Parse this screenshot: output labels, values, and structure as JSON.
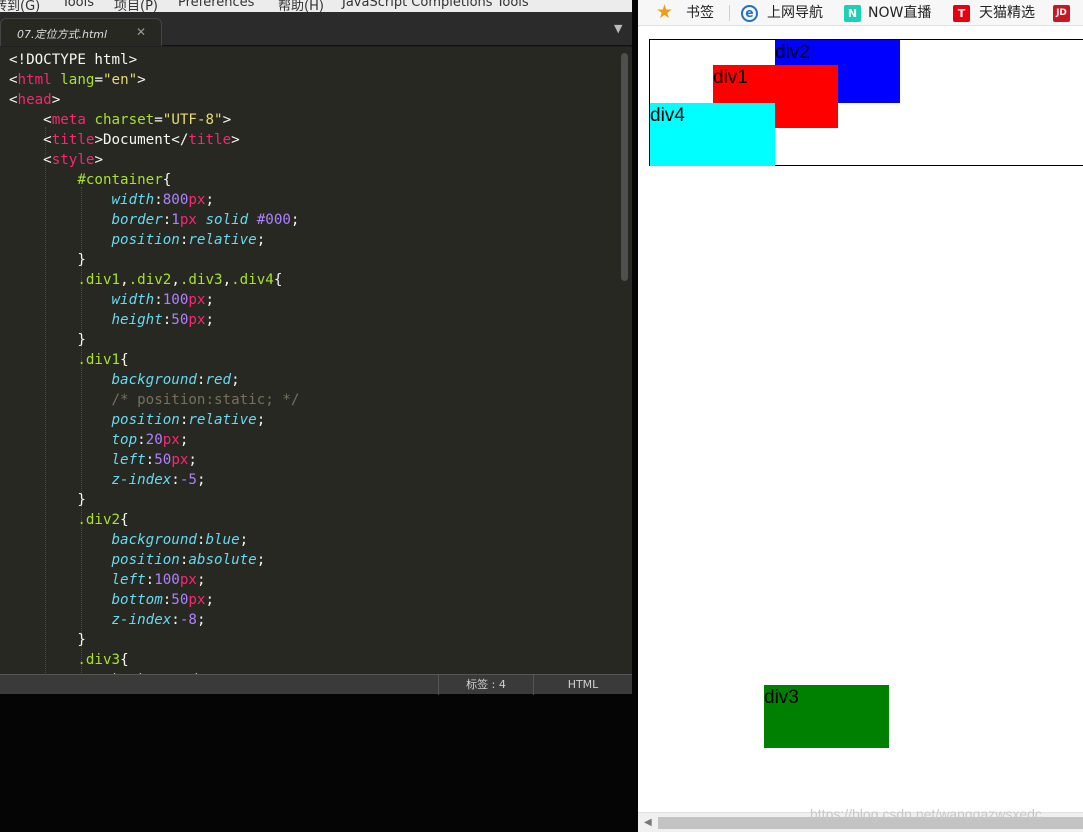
{
  "menu": {
    "items": [
      "转到(G)",
      "Tools",
      "项目(P)",
      "Preferences",
      "帮助(H)",
      "JavaScript Completions Tools"
    ]
  },
  "editor": {
    "tab": {
      "label": "07.定位方式.html"
    },
    "tab_close_icon": "close-icon",
    "tab_overflow_icon": "chevron-down-icon",
    "code": [
      [
        [
          "w",
          "<!DOCTYPE html>"
        ]
      ],
      [
        [
          "w",
          "<"
        ],
        [
          "t",
          "html"
        ],
        [
          "w",
          " "
        ],
        [
          "a",
          "lang"
        ],
        [
          "w",
          "="
        ],
        [
          "s",
          "\"en\""
        ],
        [
          "w",
          ">"
        ]
      ],
      [
        [
          "w",
          "<"
        ],
        [
          "t",
          "head"
        ],
        [
          "w",
          ">"
        ]
      ],
      [
        [
          "w",
          "    <"
        ],
        [
          "t",
          "meta"
        ],
        [
          "w",
          " "
        ],
        [
          "a",
          "charset"
        ],
        [
          "w",
          "="
        ],
        [
          "s",
          "\"UTF-8\""
        ],
        [
          "w",
          ">"
        ]
      ],
      [
        [
          "w",
          "    <"
        ],
        [
          "t",
          "title"
        ],
        [
          "w",
          ">Document</"
        ],
        [
          "t",
          "title"
        ],
        [
          "w",
          ">"
        ]
      ],
      [
        [
          "w",
          "    <"
        ],
        [
          "t",
          "style"
        ],
        [
          "w",
          ">"
        ]
      ],
      [
        [
          "w",
          "        "
        ],
        [
          "a",
          "#container"
        ],
        [
          "w",
          "{"
        ]
      ],
      [
        [
          "w",
          "            "
        ],
        [
          "p",
          "width"
        ],
        [
          "w",
          ":"
        ],
        [
          "n",
          "800"
        ],
        [
          "t",
          "px"
        ],
        [
          "w",
          ";"
        ]
      ],
      [
        [
          "w",
          "            "
        ],
        [
          "p",
          "border"
        ],
        [
          "w",
          ":"
        ],
        [
          "n",
          "1"
        ],
        [
          "t",
          "px"
        ],
        [
          "w",
          " "
        ],
        [
          "p",
          "solid"
        ],
        [
          "w",
          " "
        ],
        [
          "n",
          "#000"
        ],
        [
          "w",
          ";"
        ]
      ],
      [
        [
          "w",
          "            "
        ],
        [
          "p",
          "position"
        ],
        [
          "w",
          ":"
        ],
        [
          "p",
          "relative"
        ],
        [
          "w",
          ";"
        ]
      ],
      [
        [
          "w",
          "        }"
        ]
      ],
      [
        [
          "w",
          "        "
        ],
        [
          "a",
          ".div1"
        ],
        [
          "w",
          ","
        ],
        [
          "a",
          ".div2"
        ],
        [
          "w",
          ","
        ],
        [
          "a",
          ".div3"
        ],
        [
          "w",
          ","
        ],
        [
          "a",
          ".div4"
        ],
        [
          "w",
          "{"
        ]
      ],
      [
        [
          "w",
          "            "
        ],
        [
          "p",
          "width"
        ],
        [
          "w",
          ":"
        ],
        [
          "n",
          "100"
        ],
        [
          "t",
          "px"
        ],
        [
          "w",
          ";"
        ]
      ],
      [
        [
          "w",
          "            "
        ],
        [
          "p",
          "height"
        ],
        [
          "w",
          ":"
        ],
        [
          "n",
          "50"
        ],
        [
          "t",
          "px"
        ],
        [
          "w",
          ";"
        ]
      ],
      [
        [
          "w",
          "        }"
        ]
      ],
      [
        [
          "w",
          "        "
        ],
        [
          "a",
          ".div1"
        ],
        [
          "w",
          "{"
        ]
      ],
      [
        [
          "w",
          "            "
        ],
        [
          "p",
          "background"
        ],
        [
          "w",
          ":"
        ],
        [
          "p",
          "red"
        ],
        [
          "w",
          ";"
        ]
      ],
      [
        [
          "w",
          "            "
        ],
        [
          "c",
          "/* position:static; */"
        ]
      ],
      [
        [
          "w",
          "            "
        ],
        [
          "p",
          "position"
        ],
        [
          "w",
          ":"
        ],
        [
          "p",
          "relative"
        ],
        [
          "w",
          ";"
        ]
      ],
      [
        [
          "w",
          "            "
        ],
        [
          "p",
          "top"
        ],
        [
          "w",
          ":"
        ],
        [
          "n",
          "20"
        ],
        [
          "t",
          "px"
        ],
        [
          "w",
          ";"
        ]
      ],
      [
        [
          "w",
          "            "
        ],
        [
          "p",
          "left"
        ],
        [
          "w",
          ":"
        ],
        [
          "n",
          "50"
        ],
        [
          "t",
          "px"
        ],
        [
          "w",
          ";"
        ]
      ],
      [
        [
          "w",
          "            "
        ],
        [
          "p",
          "z-index"
        ],
        [
          "w",
          ":"
        ],
        [
          "n",
          "-5"
        ],
        [
          "w",
          ";"
        ]
      ],
      [
        [
          "w",
          "        }"
        ]
      ],
      [
        [
          "w",
          "        "
        ],
        [
          "a",
          ".div2"
        ],
        [
          "w",
          "{"
        ]
      ],
      [
        [
          "w",
          "            "
        ],
        [
          "p",
          "background"
        ],
        [
          "w",
          ":"
        ],
        [
          "p",
          "blue"
        ],
        [
          "w",
          ";"
        ]
      ],
      [
        [
          "w",
          "            "
        ],
        [
          "p",
          "position"
        ],
        [
          "w",
          ":"
        ],
        [
          "p",
          "absolute"
        ],
        [
          "w",
          ";"
        ]
      ],
      [
        [
          "w",
          "            "
        ],
        [
          "p",
          "left"
        ],
        [
          "w",
          ":"
        ],
        [
          "n",
          "100"
        ],
        [
          "t",
          "px"
        ],
        [
          "w",
          ";"
        ]
      ],
      [
        [
          "w",
          "            "
        ],
        [
          "p",
          "bottom"
        ],
        [
          "w",
          ":"
        ],
        [
          "n",
          "50"
        ],
        [
          "t",
          "px"
        ],
        [
          "w",
          ";"
        ]
      ],
      [
        [
          "w",
          "            "
        ],
        [
          "p",
          "z-index"
        ],
        [
          "w",
          ":"
        ],
        [
          "n",
          "-8"
        ],
        [
          "w",
          ";"
        ]
      ],
      [
        [
          "w",
          "        }"
        ]
      ],
      [
        [
          "w",
          "        "
        ],
        [
          "a",
          ".div3"
        ],
        [
          "w",
          "{"
        ]
      ],
      [
        [
          "w",
          "            "
        ],
        [
          "p",
          "background"
        ],
        [
          "w",
          ":"
        ]
      ]
    ],
    "status": {
      "tags": "标签 : 4",
      "syntax": "HTML"
    }
  },
  "browser": {
    "bookmarks": [
      {
        "label": "书签",
        "icon": "star-icon",
        "icon_color": "#f39c12"
      },
      {
        "label": "上网导航",
        "icon": "ie-icon",
        "icon_color": "#1e73c8"
      },
      {
        "label": "NOW直播",
        "icon": "now-icon",
        "icon_color": "#1fcfb3"
      },
      {
        "label": "天猫精选",
        "icon": "tmall-icon",
        "icon_color": "#e60012"
      },
      {
        "label": "",
        "icon": "jd-icon",
        "icon_color": "#c81623"
      }
    ],
    "icon_text": {
      "ie": "e",
      "now": "N",
      "tmall": "T",
      "jd": "JD"
    },
    "demo_boxes": {
      "div1": {
        "label": "div1",
        "color": "#ff0000"
      },
      "div2": {
        "label": "div2",
        "color": "#0000ff"
      },
      "div3": {
        "label": "div3",
        "color": "#008000"
      },
      "div4": {
        "label": "div4",
        "color": "#00ffff"
      }
    },
    "watermark": "https://blog.csdn.net/wangqazwsxedc"
  }
}
